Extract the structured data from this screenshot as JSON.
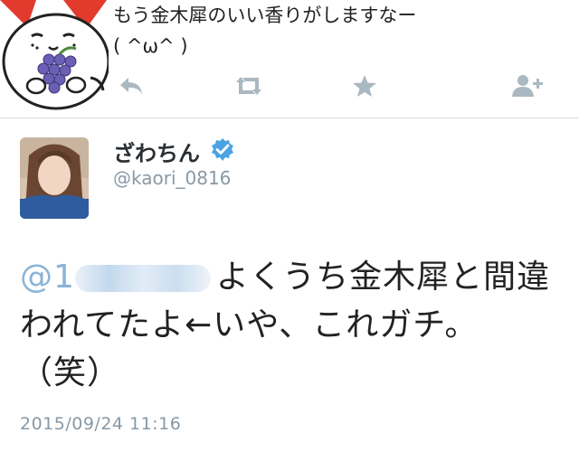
{
  "previous_tweet": {
    "line1": "もう金木犀のいい香りがしますなー",
    "line2": "( ^ω^ )",
    "avatar_icon": "cat-holding-grapes"
  },
  "actions": [
    "reply-icon",
    "retweet-icon",
    "favorite-icon",
    "follow-icon"
  ],
  "colors": {
    "mention": "#8ab3d8",
    "secondary": "#8899a6",
    "verified": "#4ba3e3",
    "divider": "#d9dde1"
  },
  "tweet": {
    "display_name": "ざわちん",
    "handle": "@kaori_0816",
    "mention_prefix": "@1",
    "text_line1": "よくうち金木犀と間違",
    "text_line2": "われてたよ←いや、これガチ。",
    "text_line3": "（笑）",
    "timestamp": "2015/09/24 11:16"
  }
}
